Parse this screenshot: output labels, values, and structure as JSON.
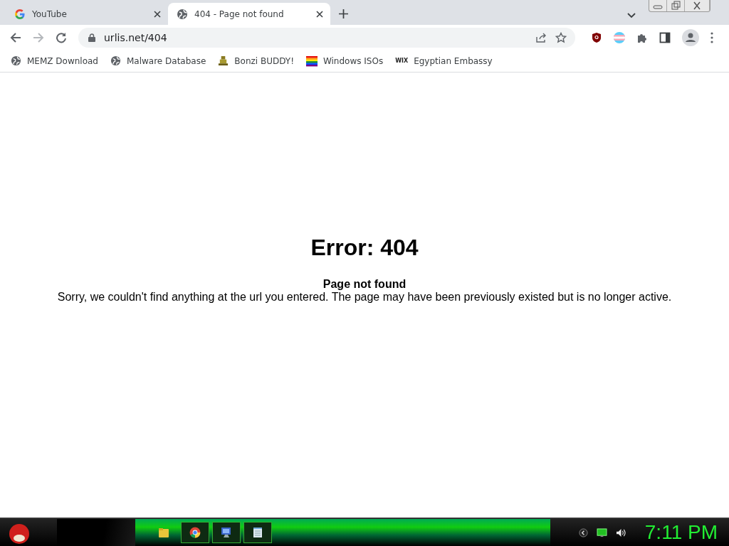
{
  "tabs": [
    {
      "title": "YouTube",
      "kind": "google",
      "selected": false
    },
    {
      "title": "404 - Page not found",
      "kind": "globe",
      "selected": true
    }
  ],
  "address": {
    "url": "urlis.net/404"
  },
  "bookmarks": [
    {
      "label": "MEMZ Download",
      "kind": "globe"
    },
    {
      "label": "Malware Database",
      "kind": "globe"
    },
    {
      "label": "Bonzi BUDDY!",
      "kind": "figure"
    },
    {
      "label": "Windows ISOs",
      "kind": "rainbow"
    },
    {
      "label": "Egyptian Embassy",
      "kind": "text",
      "icon_text": "WIX"
    }
  ],
  "page": {
    "heading": "Error: 404",
    "subheading": "Page not found",
    "message": "Sorry, we couldn't find anything at the url you entered. The page may have been previously existed but is no longer active."
  },
  "taskbar": {
    "apps": [
      {
        "kind": "folder",
        "open": false
      },
      {
        "kind": "browser",
        "open": true
      },
      {
        "kind": "monitor",
        "open": true
      },
      {
        "kind": "notepad",
        "open": true
      }
    ],
    "clock": "7:11 PM"
  }
}
